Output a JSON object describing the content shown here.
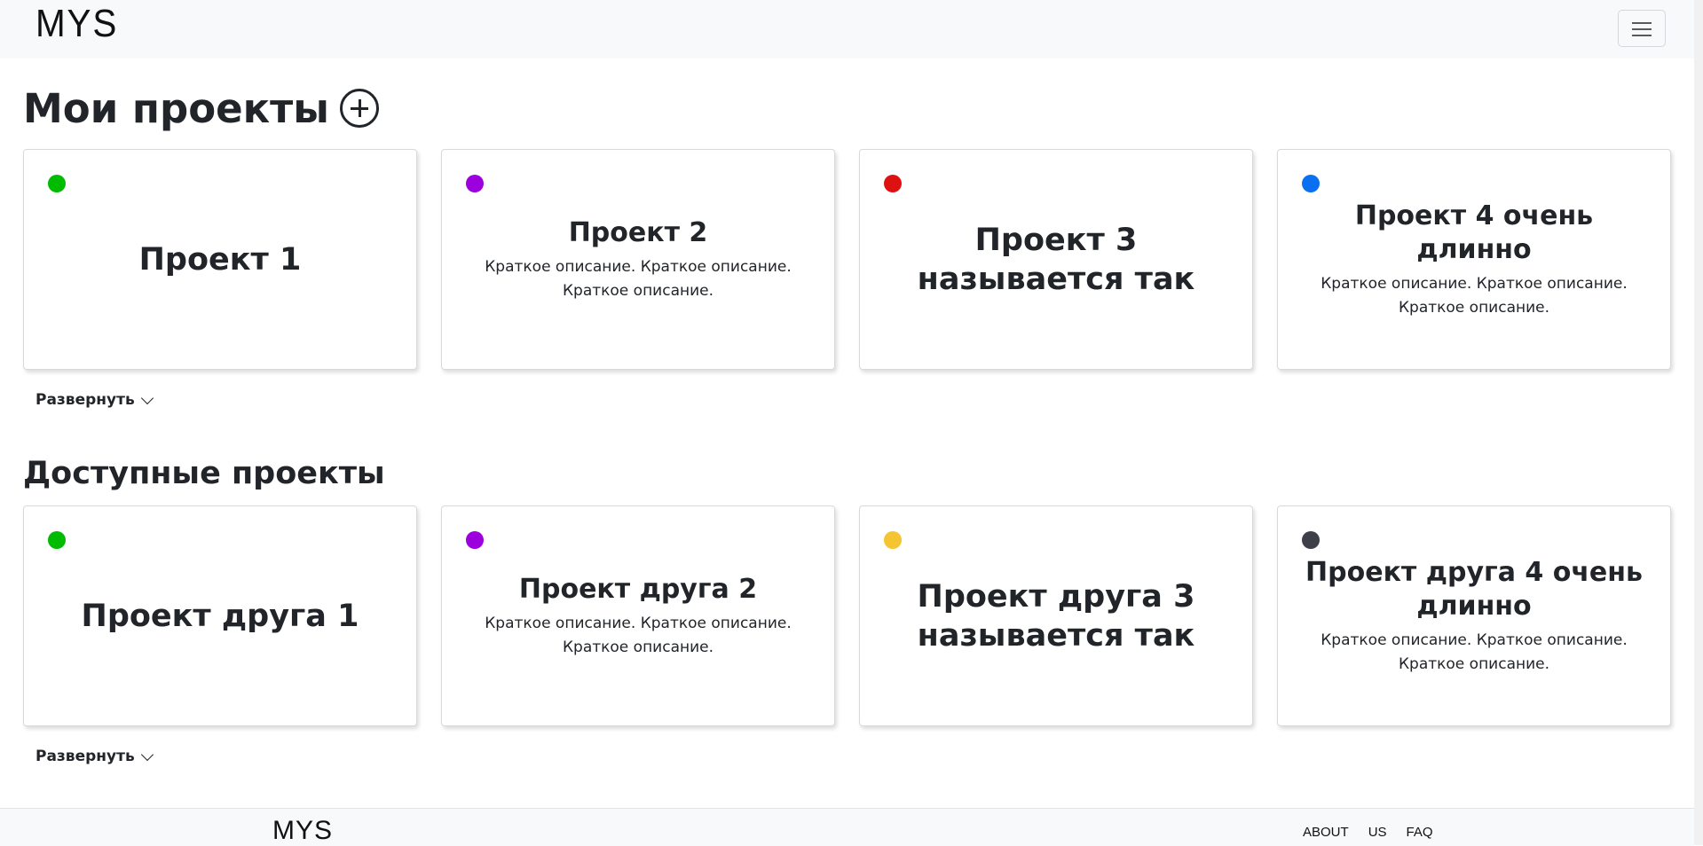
{
  "header": {
    "logo": "MYS",
    "menu_icon": "hamburger-icon"
  },
  "my_projects": {
    "title": "Мои проекты",
    "add_icon": "plus-circle-icon",
    "expand_label": "Развернуть",
    "cards": [
      {
        "title": "Проект 1",
        "description": "",
        "color": "#00bb00"
      },
      {
        "title": "Проект 2",
        "description": "Краткое описание. Краткое описание. Крат­кое описание.",
        "color": "#9b00dd"
      },
      {
        "title": "Проект 3 называется так",
        "description": "",
        "color": "#dd1111"
      },
      {
        "title": "Проект 4 очень длинно",
        "description": "Краткое описание. Краткое описание. Крат­кое описание.",
        "color": "#0a6ff0"
      }
    ]
  },
  "available_projects": {
    "title": "Доступные проекты",
    "expand_label": "Развернуть",
    "cards": [
      {
        "title": "Проект друга 1",
        "description": "",
        "color": "#00bb00"
      },
      {
        "title": "Проект друга 2",
        "description": "Краткое описание. Краткое описание. Крат­кое описание.",
        "color": "#9b00dd"
      },
      {
        "title": "Проект друга 3 назы­вается так",
        "description": "",
        "color": "#f5c431"
      },
      {
        "title": "Проект друга 4 очень длинно",
        "description": "Краткое описание. Краткое описание. Крат­кое описание.",
        "color": "#3f3f4a"
      }
    ]
  },
  "footer": {
    "logo": "MYS",
    "links": [
      "ABOUT",
      "US",
      "FAQ"
    ]
  }
}
